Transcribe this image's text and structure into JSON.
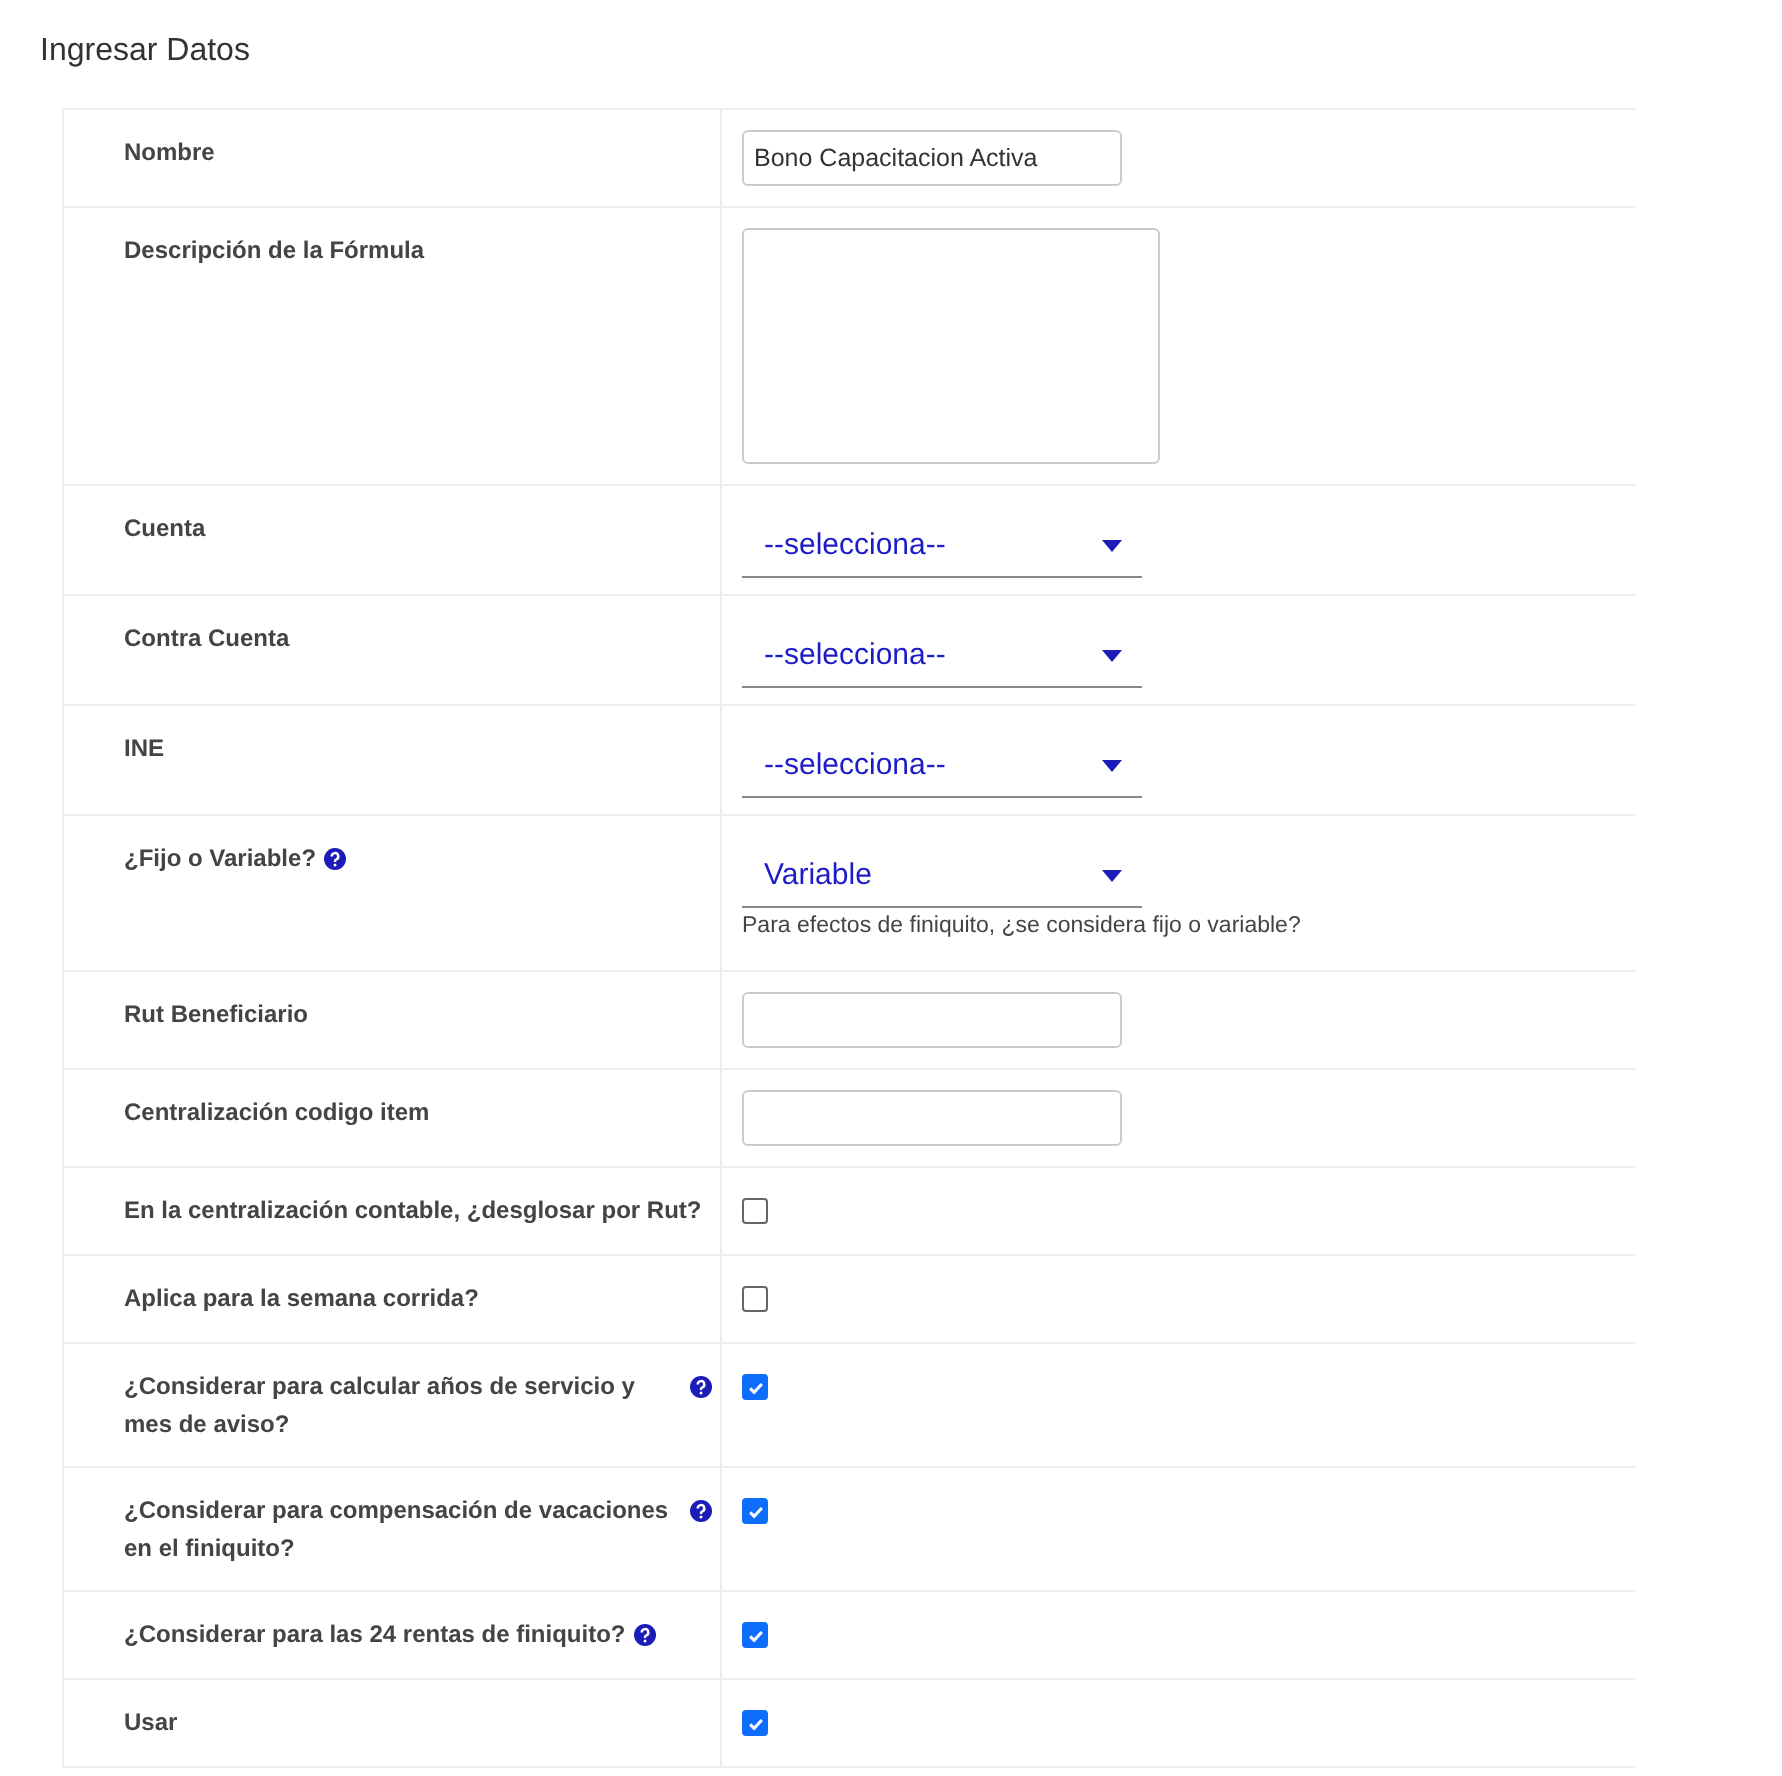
{
  "title": "Ingresar Datos",
  "rows": [
    {
      "kind": "text",
      "label": "Nombre",
      "value": "Bono Capacitacion Activa"
    },
    {
      "kind": "textarea",
      "label": "Descripción de la Fórmula"
    },
    {
      "kind": "select",
      "label": "Cuenta",
      "value": "--selecciona--"
    },
    {
      "kind": "select",
      "label": "Contra Cuenta",
      "value": "--selecciona--"
    },
    {
      "kind": "select",
      "label": "INE",
      "value": "--selecciona--"
    },
    {
      "kind": "select",
      "label": "¿Fijo o Variable?",
      "help": true,
      "value": "Variable",
      "hint": "Para efectos de finiquito, ¿se considera fijo o variable?"
    },
    {
      "kind": "text",
      "label": "Rut Beneficiario"
    },
    {
      "kind": "text",
      "label": "Centralización codigo item"
    },
    {
      "kind": "checkbox",
      "label": "En la centralización contable, ¿desglosar por Rut?",
      "checked": false
    },
    {
      "kind": "checkbox",
      "label": "Aplica para la semana corrida?",
      "checked": false
    },
    {
      "kind": "checkbox",
      "label": "¿Considerar para calcular años de servicio y mes de aviso?",
      "help": true,
      "checked": true
    },
    {
      "kind": "checkbox",
      "label": "¿Considerar para compensación de vacaciones en el finiquito?",
      "help": true,
      "checked": true
    },
    {
      "kind": "checkbox",
      "label": "¿Considerar para las 24 rentas de finiquito?",
      "help": true,
      "checked": true
    },
    {
      "kind": "checkbox",
      "label": "Usar",
      "checked": true
    }
  ]
}
